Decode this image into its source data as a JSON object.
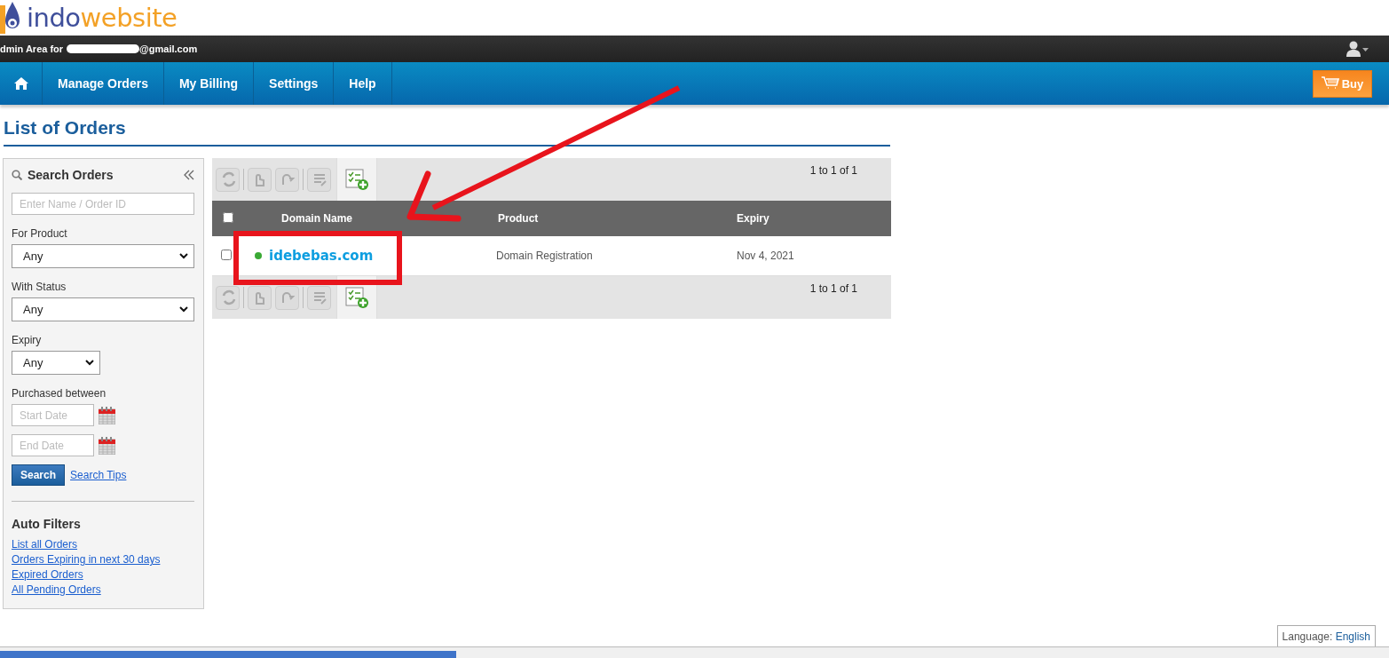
{
  "logo": {
    "text_a": "indo",
    "text_b": "website"
  },
  "account_bar": {
    "label": "dmin Area for",
    "email_suffix": "@gmail.com"
  },
  "nav": {
    "items": [
      {
        "label": "Manage Orders"
      },
      {
        "label": "My Billing"
      },
      {
        "label": "Settings"
      },
      {
        "label": "Help"
      }
    ],
    "buy_label": "Buy"
  },
  "page_title": "List of Orders",
  "sidebar": {
    "title": "Search Orders",
    "search_placeholder": "Enter Name / Order ID",
    "filters": [
      {
        "label": "For Product",
        "value": "Any",
        "wide": true
      },
      {
        "label": "With Status",
        "value": "Any",
        "wide": true
      },
      {
        "label": "Expiry",
        "value": "Any",
        "wide": false
      }
    ],
    "date_label": "Purchased between",
    "start_placeholder": "Start Date",
    "end_placeholder": "End Date",
    "search_button": "Search",
    "search_tips": "Search Tips",
    "auto_filters_title": "Auto Filters",
    "auto_filters": [
      "List all Orders",
      "Orders Expiring in next 30 days",
      "Expired Orders",
      "All Pending Orders"
    ]
  },
  "table": {
    "pagination_top": "1 to 1 of 1",
    "pagination_bottom": "1 to 1 of 1",
    "select_all_checked": false,
    "columns": [
      "Domain Name",
      "Product",
      "Expiry"
    ],
    "rows": [
      {
        "checked": false,
        "color": "#3aa935",
        "domain": "idebebas.com",
        "product": "Domain Registration",
        "expiry": "Nov 4, 2021"
      }
    ]
  },
  "language": {
    "label": "Language:",
    "value": "English"
  }
}
